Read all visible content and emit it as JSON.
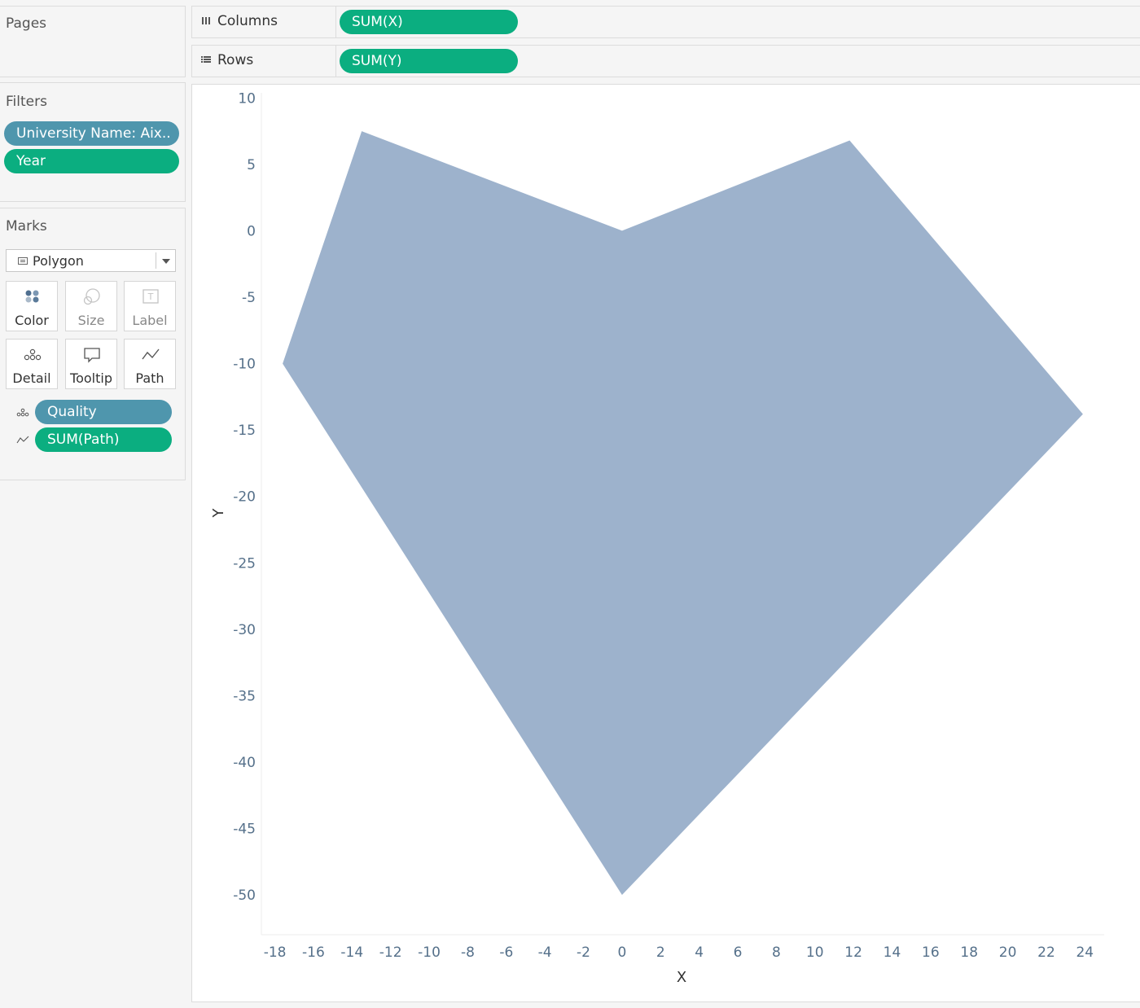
{
  "pages": {
    "title": "Pages"
  },
  "filters": {
    "title": "Filters",
    "pills": [
      "University Name: Aix..",
      "Year"
    ]
  },
  "marks": {
    "title": "Marks",
    "mark_type": "Polygon",
    "buttons": {
      "color": "Color",
      "size": "Size",
      "label": "Label",
      "detail": "Detail",
      "tooltip": "Tooltip",
      "path": "Path"
    },
    "fields": [
      {
        "label": "Quality",
        "kind": "detail"
      },
      {
        "label": "SUM(Path)",
        "kind": "path"
      }
    ]
  },
  "shelves": {
    "columns": {
      "label": "Columns",
      "pill": "SUM(X)"
    },
    "rows": {
      "label": "Rows",
      "pill": "SUM(Y)"
    }
  },
  "colors": {
    "measure_pill": "#0bae80",
    "dimension_pill": "#4f96ad",
    "polygon_fill": "#9db2cc"
  },
  "chart_data": {
    "type": "area",
    "polygon": [
      {
        "x": -13.5,
        "y": 7.5
      },
      {
        "x": 0,
        "y": 0
      },
      {
        "x": 11.8,
        "y": 6.8
      },
      {
        "x": 23.9,
        "y": -13.8
      },
      {
        "x": 0,
        "y": -50
      },
      {
        "x": -17.6,
        "y": -10
      }
    ],
    "xlabel": "X",
    "ylabel": "Y",
    "xlim": [
      -18.7,
      25
    ],
    "ylim": [
      -53,
      11
    ],
    "xticks": [
      -18,
      -16,
      -14,
      -12,
      -10,
      -8,
      -6,
      -4,
      -2,
      0,
      2,
      4,
      6,
      8,
      10,
      12,
      14,
      16,
      18,
      20,
      22,
      24
    ],
    "yticks": [
      10,
      5,
      0,
      -5,
      -10,
      -15,
      -20,
      -25,
      -30,
      -35,
      -40,
      -45,
      -50
    ],
    "grid": false
  }
}
